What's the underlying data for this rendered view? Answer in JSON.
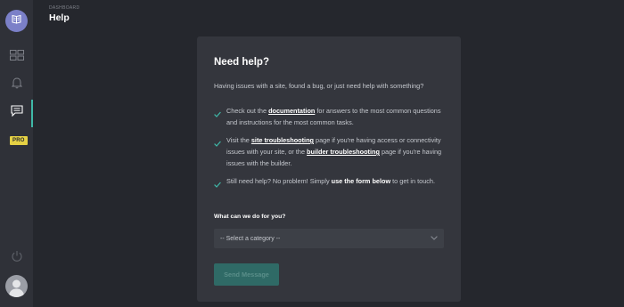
{
  "header": {
    "breadcrumb": "DASHBOARD",
    "title": "Help"
  },
  "sidebar": {
    "logo_icon": "book-icon",
    "items": [
      {
        "icon": "grid-icon",
        "active": false
      },
      {
        "icon": "bell-icon",
        "active": false
      },
      {
        "icon": "message-icon",
        "active": true
      }
    ],
    "pro_badge": "PRO",
    "power_icon": "power-icon",
    "avatar_icon": "user-avatar-icon"
  },
  "card": {
    "title": "Need help?",
    "intro": "Having issues with a site, found a bug, or just need help with something?",
    "tips": [
      {
        "pre": "Check out the ",
        "link": "documentation",
        "post": " for answers to the most common questions and instructions for the most common tasks."
      },
      {
        "pre": "Visit the ",
        "link1": "site troubleshooting",
        "mid": " page if you're having access or connectivity issues with your site, or the ",
        "link2": "builder troubleshooting",
        "post": " page if you're having issues with the builder."
      },
      {
        "pre": "Still need help? No problem! Simply ",
        "bold": "use the form below",
        "post": " to get in touch."
      }
    ],
    "form_label": "What can we do for you?",
    "select_value": "-- Select a category --",
    "send_label": "Send Message"
  },
  "colors": {
    "background": "#25272d",
    "sidebar": "#2f3138",
    "card": "#34363d",
    "accent": "#3fb8a7",
    "logo": "#7b80c8",
    "pro_badge": "#e5d144",
    "button_disabled": "#2f6a66"
  }
}
